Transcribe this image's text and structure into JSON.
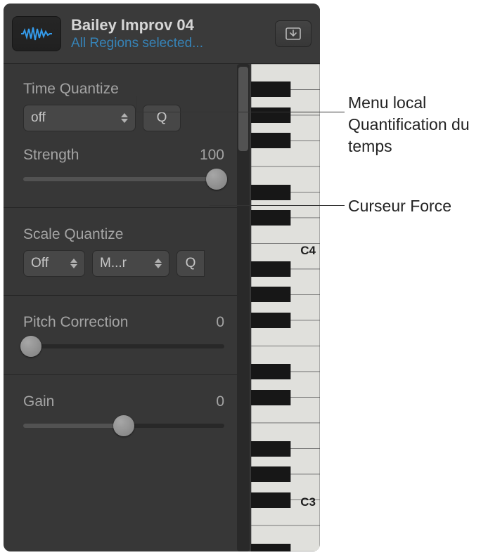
{
  "header": {
    "title": "Bailey Improv 04",
    "subtitle": "All Regions selected..."
  },
  "time_quantize": {
    "label": "Time Quantize",
    "menu_value": "off",
    "q_button": "Q",
    "strength_label": "Strength",
    "strength_value": "100"
  },
  "scale_quantize": {
    "label": "Scale Quantize",
    "key_value": "Off",
    "scale_value": "M...r",
    "q_button": "Q"
  },
  "pitch_correction": {
    "label": "Pitch Correction",
    "value": "0"
  },
  "gain": {
    "label": "Gain",
    "value": "0"
  },
  "piano": {
    "labels": {
      "c4": "C4",
      "c3": "C3"
    }
  },
  "annotations": {
    "time_quantize_menu": "Menu local Quantification du temps",
    "strength_slider": "Curseur Force"
  }
}
